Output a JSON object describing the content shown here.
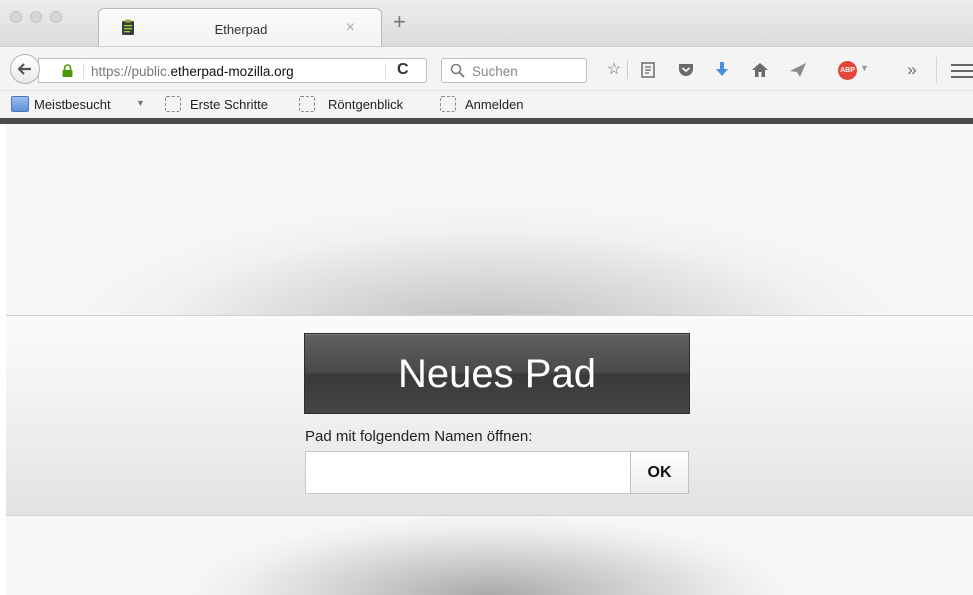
{
  "browser": {
    "tab": {
      "title": "Etherpad",
      "close_glyph": "×",
      "icon": "clipboard-icon"
    },
    "new_tab_glyph": "+",
    "address": {
      "prefix": "https://public.",
      "domain": "etherpad-mozilla.org",
      "reload_glyph": "C"
    },
    "search": {
      "placeholder": "Suchen"
    },
    "toolbar_icons": [
      "bookmark-star-icon",
      "reading-list-icon",
      "pocket-icon",
      "download-icon",
      "home-icon",
      "share-icon",
      "adblock-icon",
      "overflow-icon",
      "menu-icon"
    ],
    "adblock_label": "ABP",
    "overflow_glyph": "»",
    "bookmarks": [
      {
        "label": "Meistbesucht",
        "icon": "folder-icon"
      },
      {
        "label": "Erste Schritte",
        "icon": "bookmark-placeholder-icon"
      },
      {
        "label": "Röntgenblick",
        "icon": "bookmark-placeholder-icon"
      },
      {
        "label": "Anmelden",
        "icon": "bookmark-placeholder-icon"
      }
    ]
  },
  "page": {
    "new_pad_label": "Neues Pad",
    "open_label": "Pad mit folgendem Namen öffnen:",
    "pad_name_value": "",
    "ok_label": "OK"
  }
}
